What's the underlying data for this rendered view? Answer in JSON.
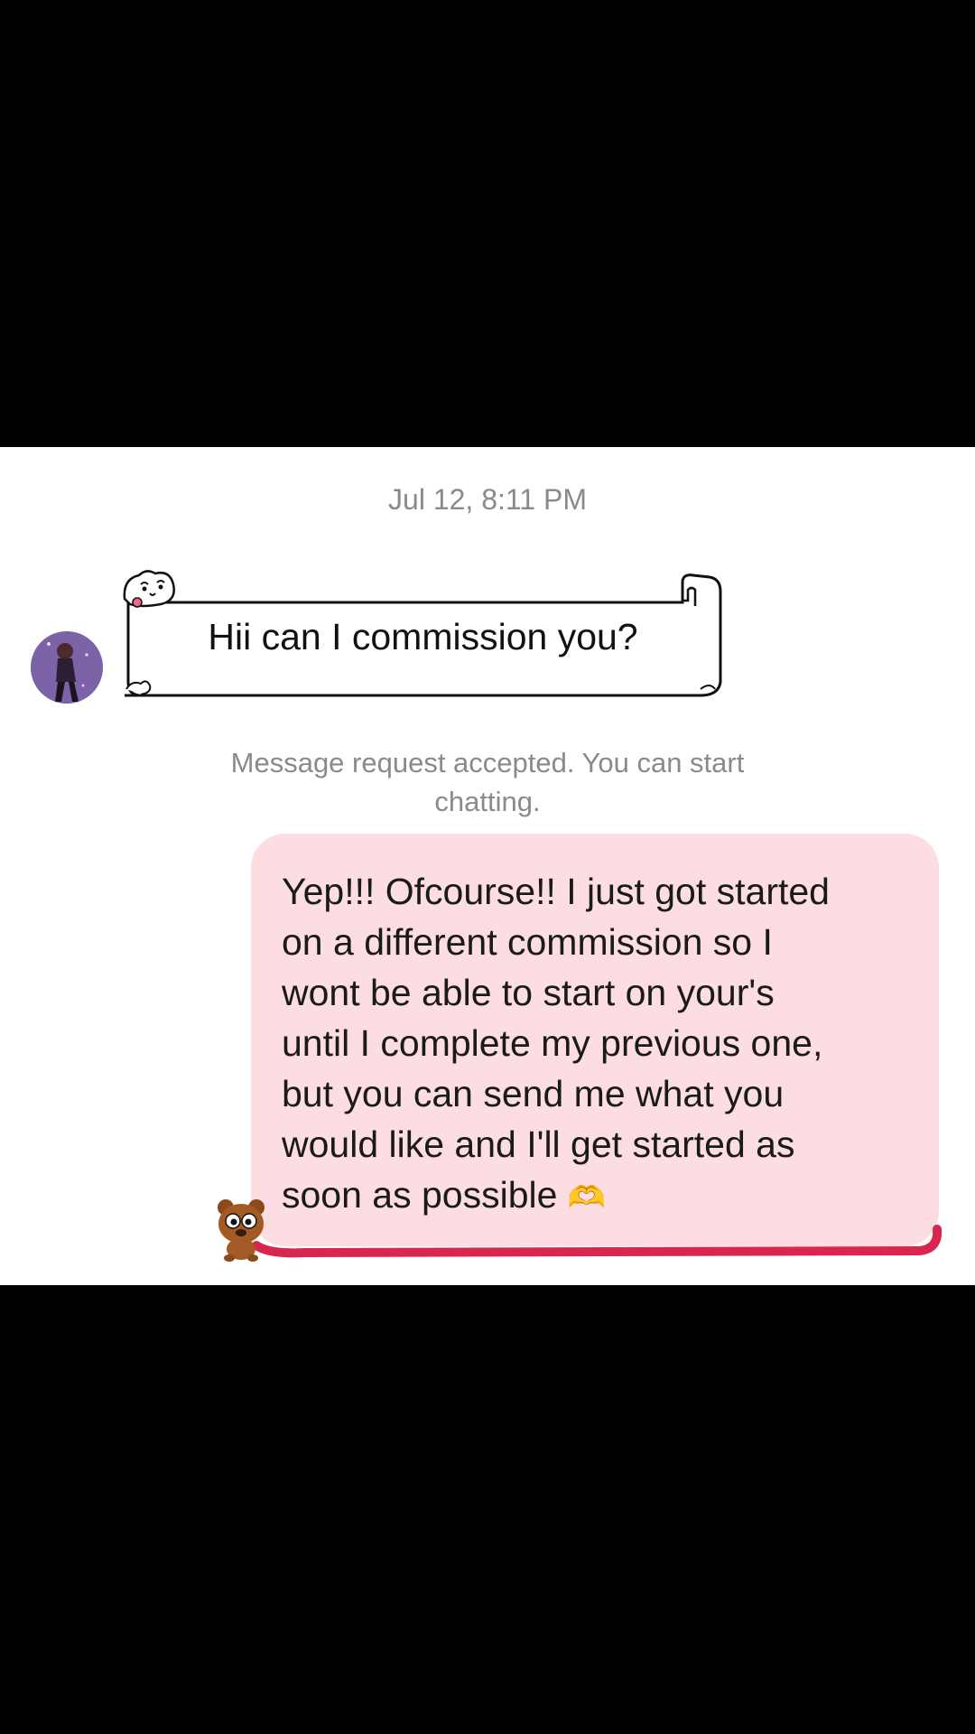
{
  "conversation": {
    "timestamp": "Jul 12, 8:11 PM",
    "incoming_message": {
      "text": "Hii can I commission you?",
      "sender_avatar": "profile-photo"
    },
    "system_message": "Message request accepted. You can start chatting.",
    "outgoing_message": {
      "text": "Yep!!! Ofcourse!! I just got started\non a different commission so I\nwont be able to start on your's\nuntil I complete my previous one,\nbut you can send me what you\nwould like and I'll get started as\nsoon as possible",
      "emoji": "🫶",
      "sticker": "bear-sticker"
    }
  },
  "colors": {
    "background": "#000000",
    "panel": "#ffffff",
    "outgoing_bubble": "#fbdde2",
    "outgoing_underline": "#d8264e",
    "muted_text": "#8a8a8a"
  }
}
